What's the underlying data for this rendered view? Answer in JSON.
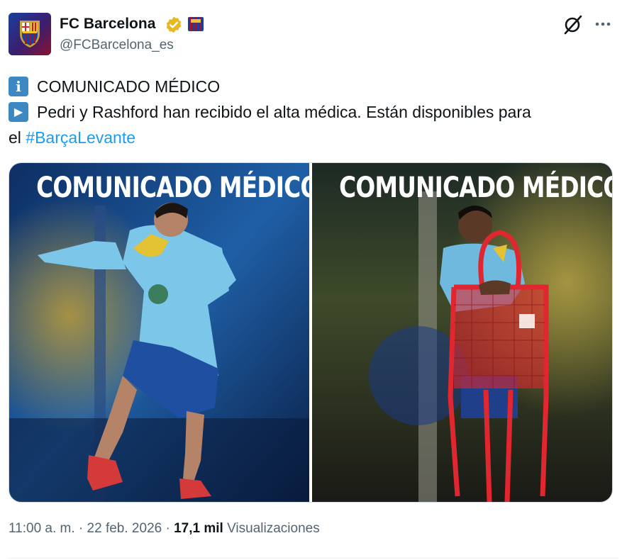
{
  "author": {
    "name": "FC Barcelona",
    "handle": "@FCBarcelona_es"
  },
  "icons": {
    "avatar": "fc-barcelona-crest",
    "verified": "verified-badge-icon",
    "flag": "barcelona-crest-emoji",
    "grok": "grok-icon",
    "more": "more-icon"
  },
  "tweet": {
    "line1_emoji": "info-emoji",
    "line1_text": "COMUNICADO MÉDICO",
    "line2_emoji": "play-emoji",
    "line2_text": "Pedri y Rashford han recibido el alta médica. Están disponibles para",
    "line3_text": "el ",
    "hashtag": "#BarçaLevante"
  },
  "media": {
    "left_title": "COMUNICADO MÉDICO",
    "right_title": "COMUNICADO MÉDICO"
  },
  "meta": {
    "time": "11:00 a. m.",
    "separator1": " · ",
    "date": "22 feb. 2026",
    "separator2": " · ",
    "views_count": "17,1 mil",
    "views_label": " Visualizaciones"
  },
  "colors": {
    "link": "#1d9bf0",
    "secondary_text": "#536471",
    "verified_gold": "#e8b824"
  }
}
